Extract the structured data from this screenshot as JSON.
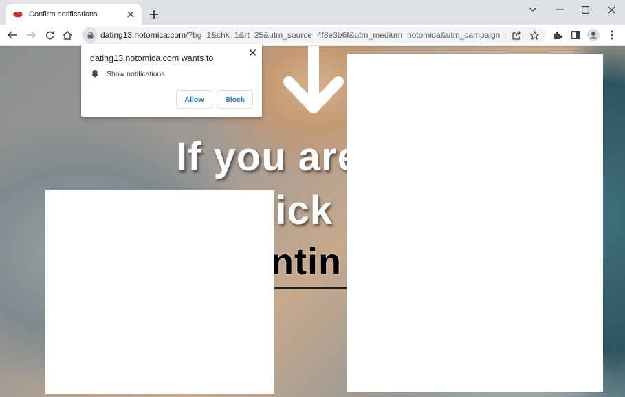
{
  "browser": {
    "tab": {
      "title": "Confirm notifications",
      "favicon": "lips-icon",
      "favicon_color": "#d93025"
    },
    "toolbar": {
      "url_host": "dating13.notomica.com",
      "url_rest": "/?bg=1&chk=1&rt=25&utm_source=4f8e3b6f&utm_medium=notomica&utm_campaign=..."
    }
  },
  "permission_prompt": {
    "origin_text": "dating13.notomica.com wants to",
    "permission_label": "Show notifications",
    "allow_label": "Allow",
    "block_label": "Block",
    "accent_color": "#1a73e8"
  },
  "page": {
    "line1": "If you are",
    "line2": "click",
    "line3": "ontin"
  }
}
